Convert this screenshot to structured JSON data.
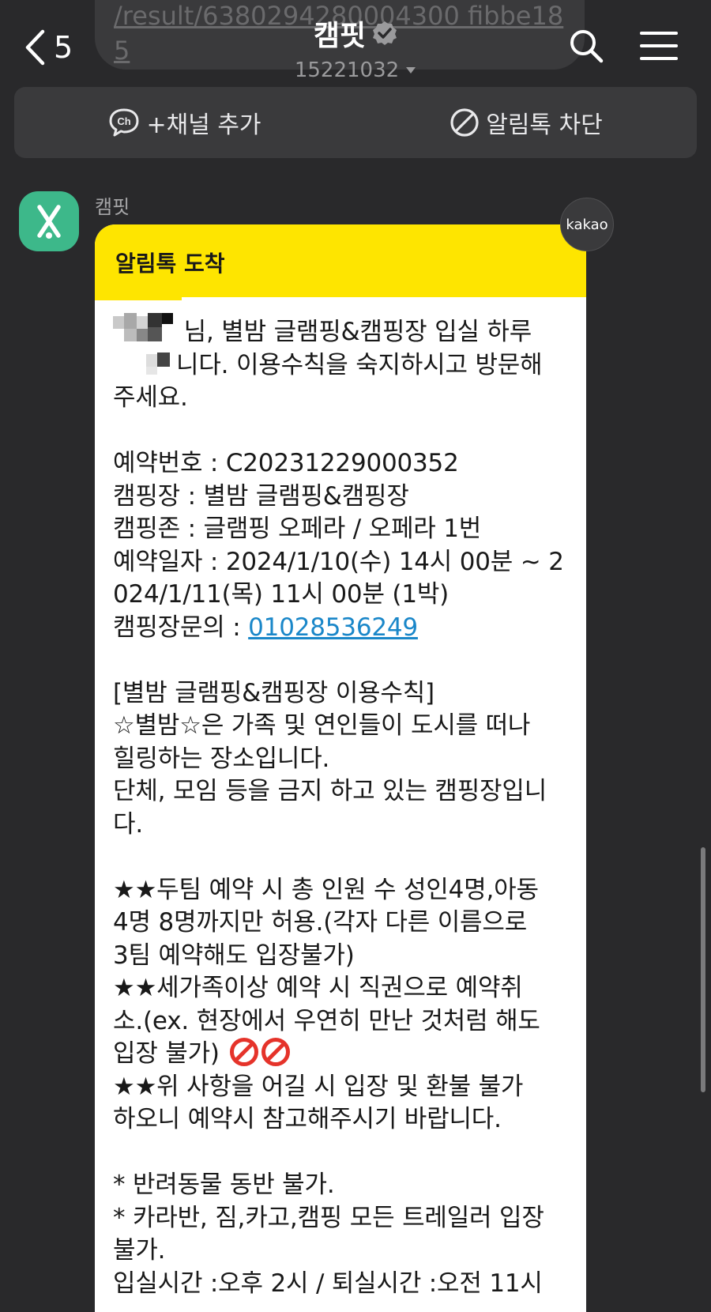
{
  "previous_message": {
    "line1": "/result/6380294280004300 fibbe18",
    "line2": "5"
  },
  "header": {
    "back_count": "5",
    "title": "캠핏",
    "subtitle": "15221032"
  },
  "action_bar": {
    "add_channel_label": "+채널 추가",
    "block_label": "알림톡 차단"
  },
  "sender": {
    "name": "캠핏",
    "badge": "kakao"
  },
  "message": {
    "header": "알림톡 도착",
    "greeting_1": "님, 별밤 글램핑&캠핑장 입실 하루",
    "greeting_2": "니다. 이용수칙을 숙지하시고 방문해",
    "greeting_3": "주세요.",
    "reservation_no": "예약번호 : C20231229000352",
    "campsite": "캠핑장 : 별밤 글램핑&캠핑장",
    "zone": "캠핑존 : 글램핑 오페라 / 오페라 1번",
    "date_1": "예약일자 : 2024/1/10(수) 14시 00분 ~ 2",
    "date_2": "024/1/11(목) 11시 00분 (1박)",
    "inquiry_label": "캠핑장문의 : ",
    "inquiry_phone": "01028536249",
    "rules_title": "[별밤 글램핑&캠핑장 이용수칙]",
    "rules_1": "☆별밤☆은 가족 및 연인들이 도시를 떠나",
    "rules_2": "힐링하는 장소입니다.",
    "rules_3": "단체, 모임 등을 금지 하고 있는 캠핑장입니",
    "rules_4": "다.",
    "star_1a": "★★두팀 예약 시 총 인원 수 성인4명,아동",
    "star_1b": "4명 8명까지만 허용.(각자 다른 이름으로",
    "star_1c": "3팀 예약해도 입장불가)",
    "star_2a": "★★세가족이상 예약 시 직권으로 예약취",
    "star_2b": "소.(ex. 현장에서 우연히 만난 것처럼 해도",
    "star_2c": "입장 불가)",
    "star_3a": "★★위 사항을 어길 시 입장 및 환불 불가",
    "star_3b": "하오니 예약시 참고해주시기 바랍니다.",
    "note_1": "* 반려동물 동반 불가.",
    "note_2a": "* 카라반, 짐,카고,캠핑 모든 트레일러 입장",
    "note_2b": "불가.",
    "checkin": "입실시간 :오후 2시 / 퇴실시간 :오전 11시"
  },
  "colors": {
    "background": "#29292b",
    "card_header": "#fee500",
    "avatar": "#3db88a",
    "link": "#1a87c9"
  }
}
